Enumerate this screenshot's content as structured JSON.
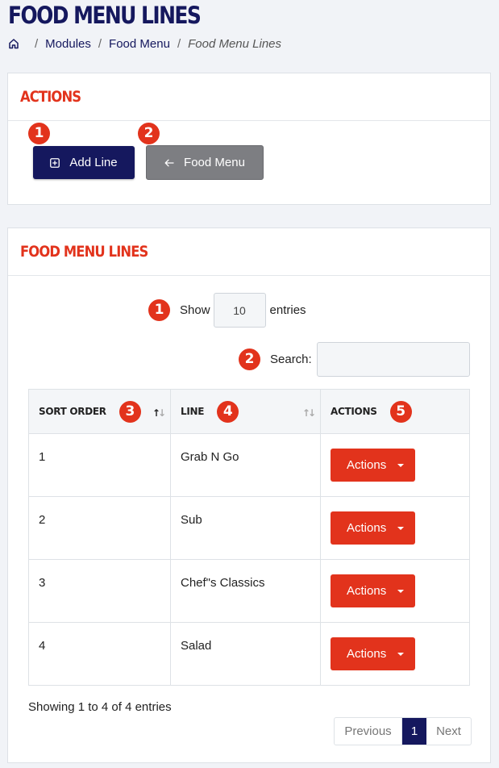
{
  "page": {
    "title": "FOOD MENU LINES"
  },
  "breadcrumb": {
    "items": [
      "Modules",
      "Food Menu"
    ],
    "current": "Food Menu Lines",
    "sep": "/"
  },
  "actions_card": {
    "title": "ACTIONS",
    "add_line": {
      "label": "Add Line",
      "badge": "1",
      "icon": "plus-square-icon"
    },
    "food_menu": {
      "label": "Food Menu",
      "badge": "2",
      "icon": "arrow-left-icon"
    }
  },
  "lines_card": {
    "title": "FOOD MENU LINES",
    "show": {
      "badge": "1",
      "label_before": "Show",
      "value": "10",
      "label_after": "entries"
    },
    "search": {
      "badge": "2",
      "label": "Search:",
      "value": ""
    },
    "columns": [
      {
        "label": "SORT ORDER",
        "badge": "3"
      },
      {
        "label": "LINE",
        "badge": "4"
      },
      {
        "label": "ACTIONS",
        "badge": "5"
      }
    ],
    "rows": [
      {
        "order": "1",
        "line": "Grab N Go",
        "action": "Actions"
      },
      {
        "order": "2",
        "line": "Sub",
        "action": "Actions"
      },
      {
        "order": "3",
        "line": "Chef\"s Classics",
        "action": "Actions"
      },
      {
        "order": "4",
        "line": "Salad",
        "action": "Actions"
      }
    ],
    "info": "Showing 1 to 4 of 4 entries",
    "pager": {
      "prev": "Previous",
      "current": "1",
      "next": "Next"
    }
  },
  "colors": {
    "navy": "#15185e",
    "accent": "#e2331c",
    "gray_button": "#7d7e82"
  }
}
